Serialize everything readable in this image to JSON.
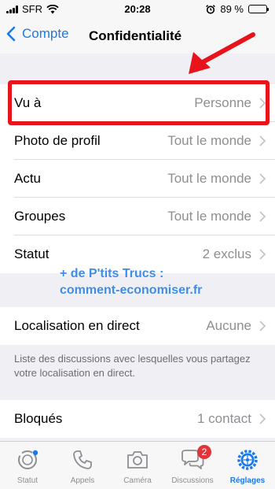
{
  "status_bar": {
    "carrier": "SFR",
    "time": "20:28",
    "battery_text": "89 %",
    "battery_level": 0.89
  },
  "nav": {
    "back_label": "Compte",
    "title": "Confidentialité"
  },
  "privacy_rows": [
    {
      "label": "Vu à",
      "value": "Personne"
    },
    {
      "label": "Photo de profil",
      "value": "Tout le monde"
    },
    {
      "label": "Actu",
      "value": "Tout le monde"
    },
    {
      "label": "Groupes",
      "value": "Tout le monde"
    },
    {
      "label": "Statut",
      "value": "2 exclus"
    }
  ],
  "overlay": {
    "line1": "+ de P'tits Trucs :",
    "line2": "comment-economiser.fr"
  },
  "location_row": {
    "label": "Localisation en direct",
    "value": "Aucune"
  },
  "location_footnote": "Liste des discussions avec lesquelles vous partagez votre localisation en direct.",
  "blocked_row": {
    "label": "Bloqués",
    "value": "1 contact"
  },
  "tabs": [
    {
      "label": "Statut",
      "icon": "status-ring-icon"
    },
    {
      "label": "Appels",
      "icon": "phone-icon"
    },
    {
      "label": "Caméra",
      "icon": "camera-icon"
    },
    {
      "label": "Discussions",
      "icon": "chat-bubbles-icon",
      "badge": "2"
    },
    {
      "label": "Réglages",
      "icon": "gear-icon",
      "active": true
    }
  ],
  "colors": {
    "accent": "#1b7aeb",
    "highlight": "#e8131b",
    "badge": "#e0343a"
  }
}
